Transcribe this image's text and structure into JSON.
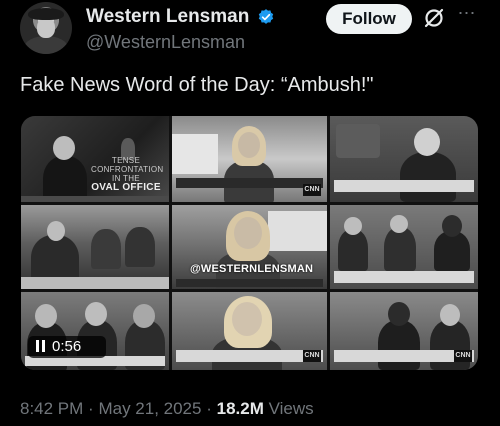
{
  "author": {
    "display_name": "Western Lensman",
    "handle": "@WesternLensman",
    "verified": true,
    "verified_color": "#1d9bf0"
  },
  "actions": {
    "follow_label": "Follow",
    "grok_icon": "grok-icon",
    "more_icon": "more-dots-icon"
  },
  "tweet": {
    "text": "Fake News Word of the Day: “Ambush!\""
  },
  "media": {
    "video_time": "0:56",
    "watermark": "@WESTERNLENSMAN",
    "tile1_label_line1": "TENSE CONFRONTATION",
    "tile1_label_line2": "IN THE",
    "tile1_label_big": "OVAL OFFICE",
    "network_badge": "CNN"
  },
  "meta": {
    "time": "8:42 PM",
    "separator": "·",
    "date": "May 21, 2025",
    "views_count": "18.2M",
    "views_label": "Views"
  }
}
